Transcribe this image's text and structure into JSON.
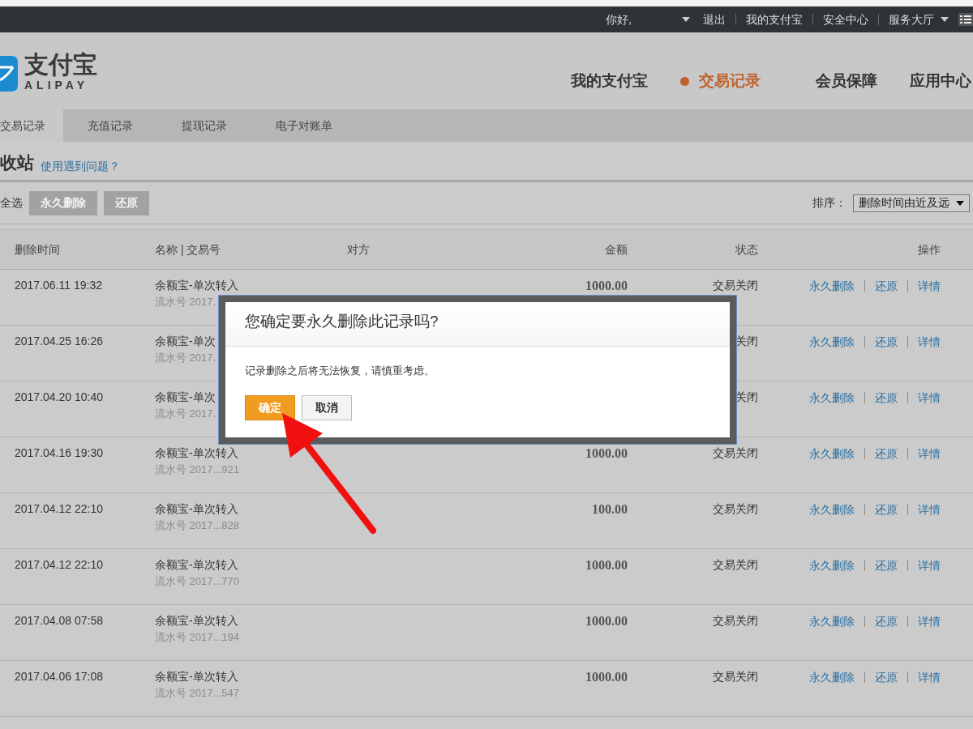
{
  "top_bar": {
    "greeting": "你好,",
    "links": [
      "退出",
      "我的支付宝",
      "安全中心"
    ],
    "service_menu": "服务大厅"
  },
  "logo": {
    "cn": "支付宝",
    "en": "ALIPAY"
  },
  "main_nav": [
    {
      "label": "我的支付宝",
      "selected": false
    },
    {
      "label": "交易记录",
      "selected": true
    },
    {
      "label": "会员保障",
      "selected": false
    },
    {
      "label": "应用中心",
      "selected": false
    }
  ],
  "sub_nav": [
    {
      "label": "交易记录",
      "selected": true
    },
    {
      "label": "充值记录",
      "selected": false
    },
    {
      "label": "提现记录",
      "selected": false
    },
    {
      "label": "电子对账单",
      "selected": false
    }
  ],
  "page_title": "收站",
  "help_link": "使用遇到问题？",
  "toolbar": {
    "select_all": "全选",
    "buttons": [
      {
        "label": "永久删除",
        "disabled": true
      },
      {
        "label": "还原",
        "disabled": true
      }
    ],
    "sort_label": "排序：",
    "sort_value": "删除时间由近及远"
  },
  "table": {
    "columns": [
      "删除时间",
      "名称 | 交易号",
      "对方",
      "金额",
      "状态",
      "操作"
    ],
    "rows": [
      {
        "time": "2017.06.11 19:32",
        "name": "余额宝-单次转入",
        "serial": "流水号 2017.",
        "amount": "1000.00",
        "status": "交易关闭",
        "actions": [
          "永久删除",
          "还原",
          "详情"
        ]
      },
      {
        "time": "2017.04.25 16:26",
        "name": "余额宝-单次",
        "serial": "流水号 2017.",
        "status": "关闭",
        "actions": [
          "永久删除",
          "还原",
          "详情"
        ]
      },
      {
        "time": "2017.04.20 10:40",
        "name": "余额宝-单次",
        "serial": "流水号 2017.",
        "status": "关闭",
        "actions": [
          "永久删除",
          "还原",
          "详情"
        ]
      },
      {
        "time": "2017.04.16 19:30",
        "name": "余额宝-单次转入",
        "serial": "流水号 2017...921",
        "amount": "1000.00",
        "status": "交易关闭",
        "actions": [
          "永久删除",
          "还原",
          "详情"
        ]
      },
      {
        "time": "2017.04.12 22:10",
        "name": "余额宝-单次转入",
        "serial": "流水号 2017...828",
        "amount": "100.00",
        "status": "交易关闭",
        "actions": [
          "永久删除",
          "还原",
          "详情"
        ]
      },
      {
        "time": "2017.04.12 22:10",
        "name": "余额宝-单次转入",
        "serial": "流水号 2017...770",
        "amount": "1000.00",
        "status": "交易关闭",
        "actions": [
          "永久删除",
          "还原",
          "详情"
        ]
      },
      {
        "time": "2017.04.08 07:58",
        "name": "余额宝-单次转入",
        "serial": "流水号 2017...194",
        "amount": "1000.00",
        "status": "交易关闭",
        "actions": [
          "永久删除",
          "还原",
          "详情"
        ]
      },
      {
        "time": "2017.04.06 17:08",
        "name": "余额宝-单次转入",
        "serial": "流水号 2017...547",
        "amount": "1000.00",
        "status": "交易关闭",
        "actions": [
          "永久删除",
          "还原",
          "详情"
        ]
      }
    ]
  },
  "dialog": {
    "title": "您确定要永久删除此记录吗?",
    "message": "记录删除之后将无法恢复，请慎重考虑。",
    "buttons": [
      {
        "label": "确定",
        "kind": "primary"
      },
      {
        "label": "取消",
        "kind": "secondary"
      }
    ]
  }
}
